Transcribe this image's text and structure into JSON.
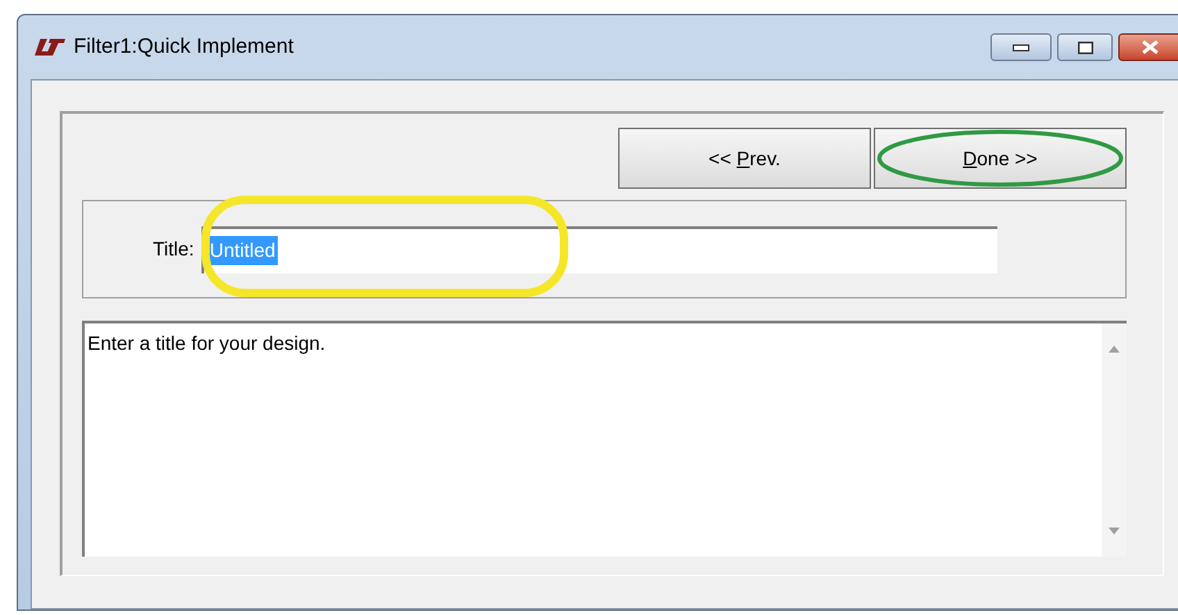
{
  "window": {
    "title": "Filter1:Quick Implement"
  },
  "buttons": [
    {
      "before": "<< ",
      "mnemonic": "P",
      "after": "rev.",
      "circled": false
    },
    {
      "mnemonic": "D",
      "after": "one >>",
      "circled": true
    }
  ],
  "title_field": {
    "label": "Title:",
    "value": "Untitled",
    "text_selected": true,
    "circled": true
  },
  "description": {
    "text": "Enter a title for your design."
  }
}
